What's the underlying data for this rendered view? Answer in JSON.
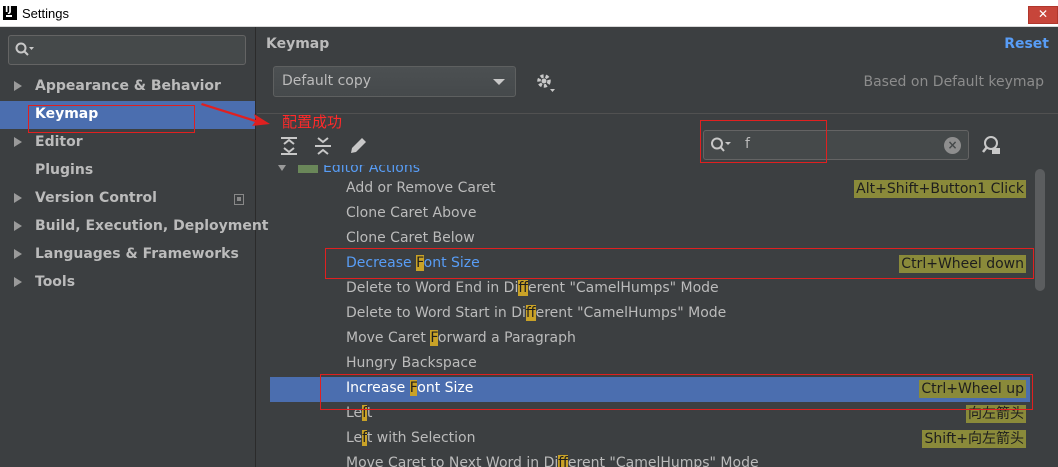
{
  "window": {
    "title": "Settings",
    "close": "✕"
  },
  "sidebar": {
    "search_placeholder": "",
    "items": [
      {
        "label": "Appearance & Behavior",
        "expandable": true
      },
      {
        "label": "Keymap",
        "expandable": false,
        "selected": true
      },
      {
        "label": "Editor",
        "expandable": true
      },
      {
        "label": "Plugins",
        "expandable": false
      },
      {
        "label": "Version Control",
        "expandable": true
      },
      {
        "label": "Build, Execution, Deployment",
        "expandable": true
      },
      {
        "label": "Languages & Frameworks",
        "expandable": true
      },
      {
        "label": "Tools",
        "expandable": true
      }
    ]
  },
  "keymap": {
    "title": "Keymap",
    "reset": "Reset",
    "scheme": "Default copy",
    "based_on": "Based on Default keymap",
    "search_query": "f",
    "annotation": "配置成功"
  },
  "tree": {
    "group": "Editor Actions",
    "rows": [
      {
        "pre": "Add or Remove Caret",
        "hl": "",
        "post": "",
        "shortcut": "Alt+Shift+Button1 Click"
      },
      {
        "pre": "Clone Caret Above",
        "hl": "",
        "post": "",
        "shortcut": ""
      },
      {
        "pre": "Clone Caret Below",
        "hl": "",
        "post": "",
        "shortcut": ""
      },
      {
        "pre": "Decrease ",
        "hl": "F",
        "post": "ont Size",
        "shortcut": "Ctrl+Wheel down"
      },
      {
        "pre": "Delete to Word End in Di",
        "hl": "ff",
        "post": "erent \"CamelHumps\" Mode",
        "shortcut": ""
      },
      {
        "pre": "Delete to Word Start in Di",
        "hl": "ff",
        "post": "erent \"CamelHumps\" Mode",
        "shortcut": ""
      },
      {
        "pre": "Move Caret ",
        "hl": "F",
        "post": "orward a Paragraph",
        "shortcut": ""
      },
      {
        "pre": "Hungry Backspace",
        "hl": "",
        "post": "",
        "shortcut": ""
      },
      {
        "pre": "Increase ",
        "hl": "F",
        "post": "ont Size",
        "shortcut": "Ctrl+Wheel up"
      },
      {
        "pre": "Le",
        "hl": "f",
        "post": "t",
        "shortcut": "向左箭头"
      },
      {
        "pre": "Le",
        "hl": "f",
        "post": "t with Selection",
        "shortcut": "Shift+向左箭头"
      },
      {
        "pre": "Move Caret to Next Word in Di",
        "hl": "ff",
        "post": "erent \"CamelHumps\" Mode",
        "shortcut": ""
      }
    ]
  },
  "colors": {
    "selection": "#4b6eaf",
    "link": "#589df6",
    "annotation": "#e02020",
    "match_highlight": "#c9a227"
  }
}
